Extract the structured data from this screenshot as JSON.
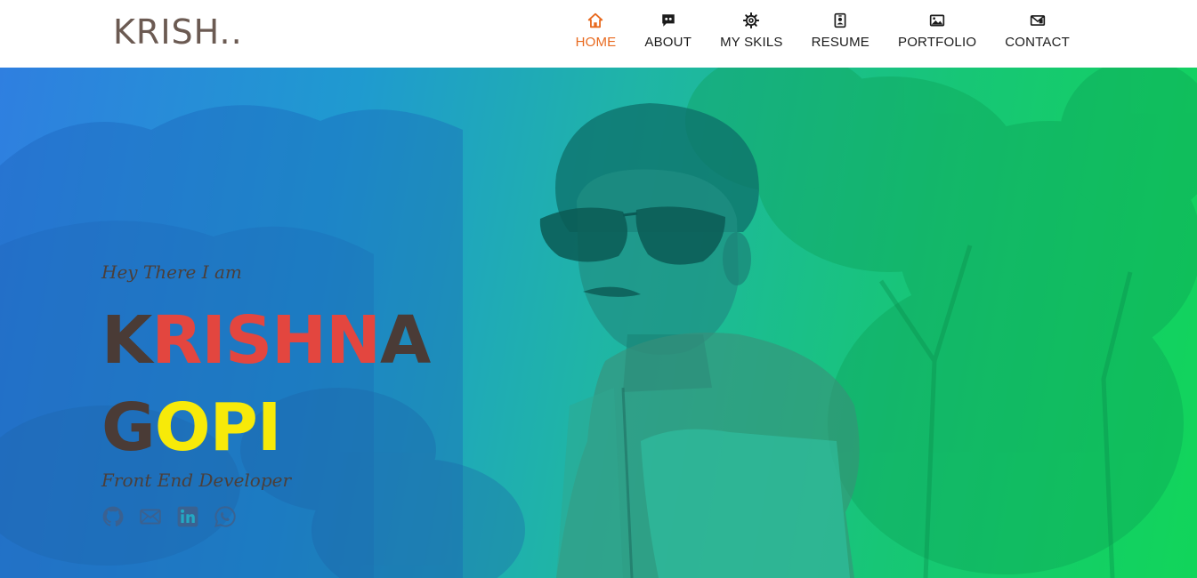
{
  "brand": {
    "text": "KRISH.."
  },
  "nav": {
    "items": [
      {
        "label": "HOME",
        "icon": "home-icon",
        "active": true
      },
      {
        "label": "ABOUT",
        "icon": "chat-quote-icon",
        "active": false
      },
      {
        "label": "MY SKILS",
        "icon": "gear-icon",
        "active": false
      },
      {
        "label": "RESUME",
        "icon": "id-badge-icon",
        "active": false
      },
      {
        "label": "PORTFOLIO",
        "icon": "image-icon",
        "active": false
      },
      {
        "label": "CONTACT",
        "icon": "envelope-icon",
        "active": false
      }
    ]
  },
  "hero": {
    "greeting": "Hey There I am",
    "first_name": {
      "k": "K",
      "rishn": "RISHN",
      "a": "A"
    },
    "last_name": {
      "g": "G",
      "opi": "OPI"
    },
    "role": "Front End Developer",
    "socials": [
      "github-icon",
      "mail-icon",
      "linkedin-icon",
      "whatsapp-icon"
    ]
  },
  "colors": {
    "accent": "#e86a1f",
    "brand": "#6b5a52",
    "name_dark": "#4a3b36",
    "name_red": "#e3463f",
    "name_yellow": "#f7ea09",
    "gradient_left": "#2f7fe0",
    "gradient_right": "#11d55a"
  }
}
